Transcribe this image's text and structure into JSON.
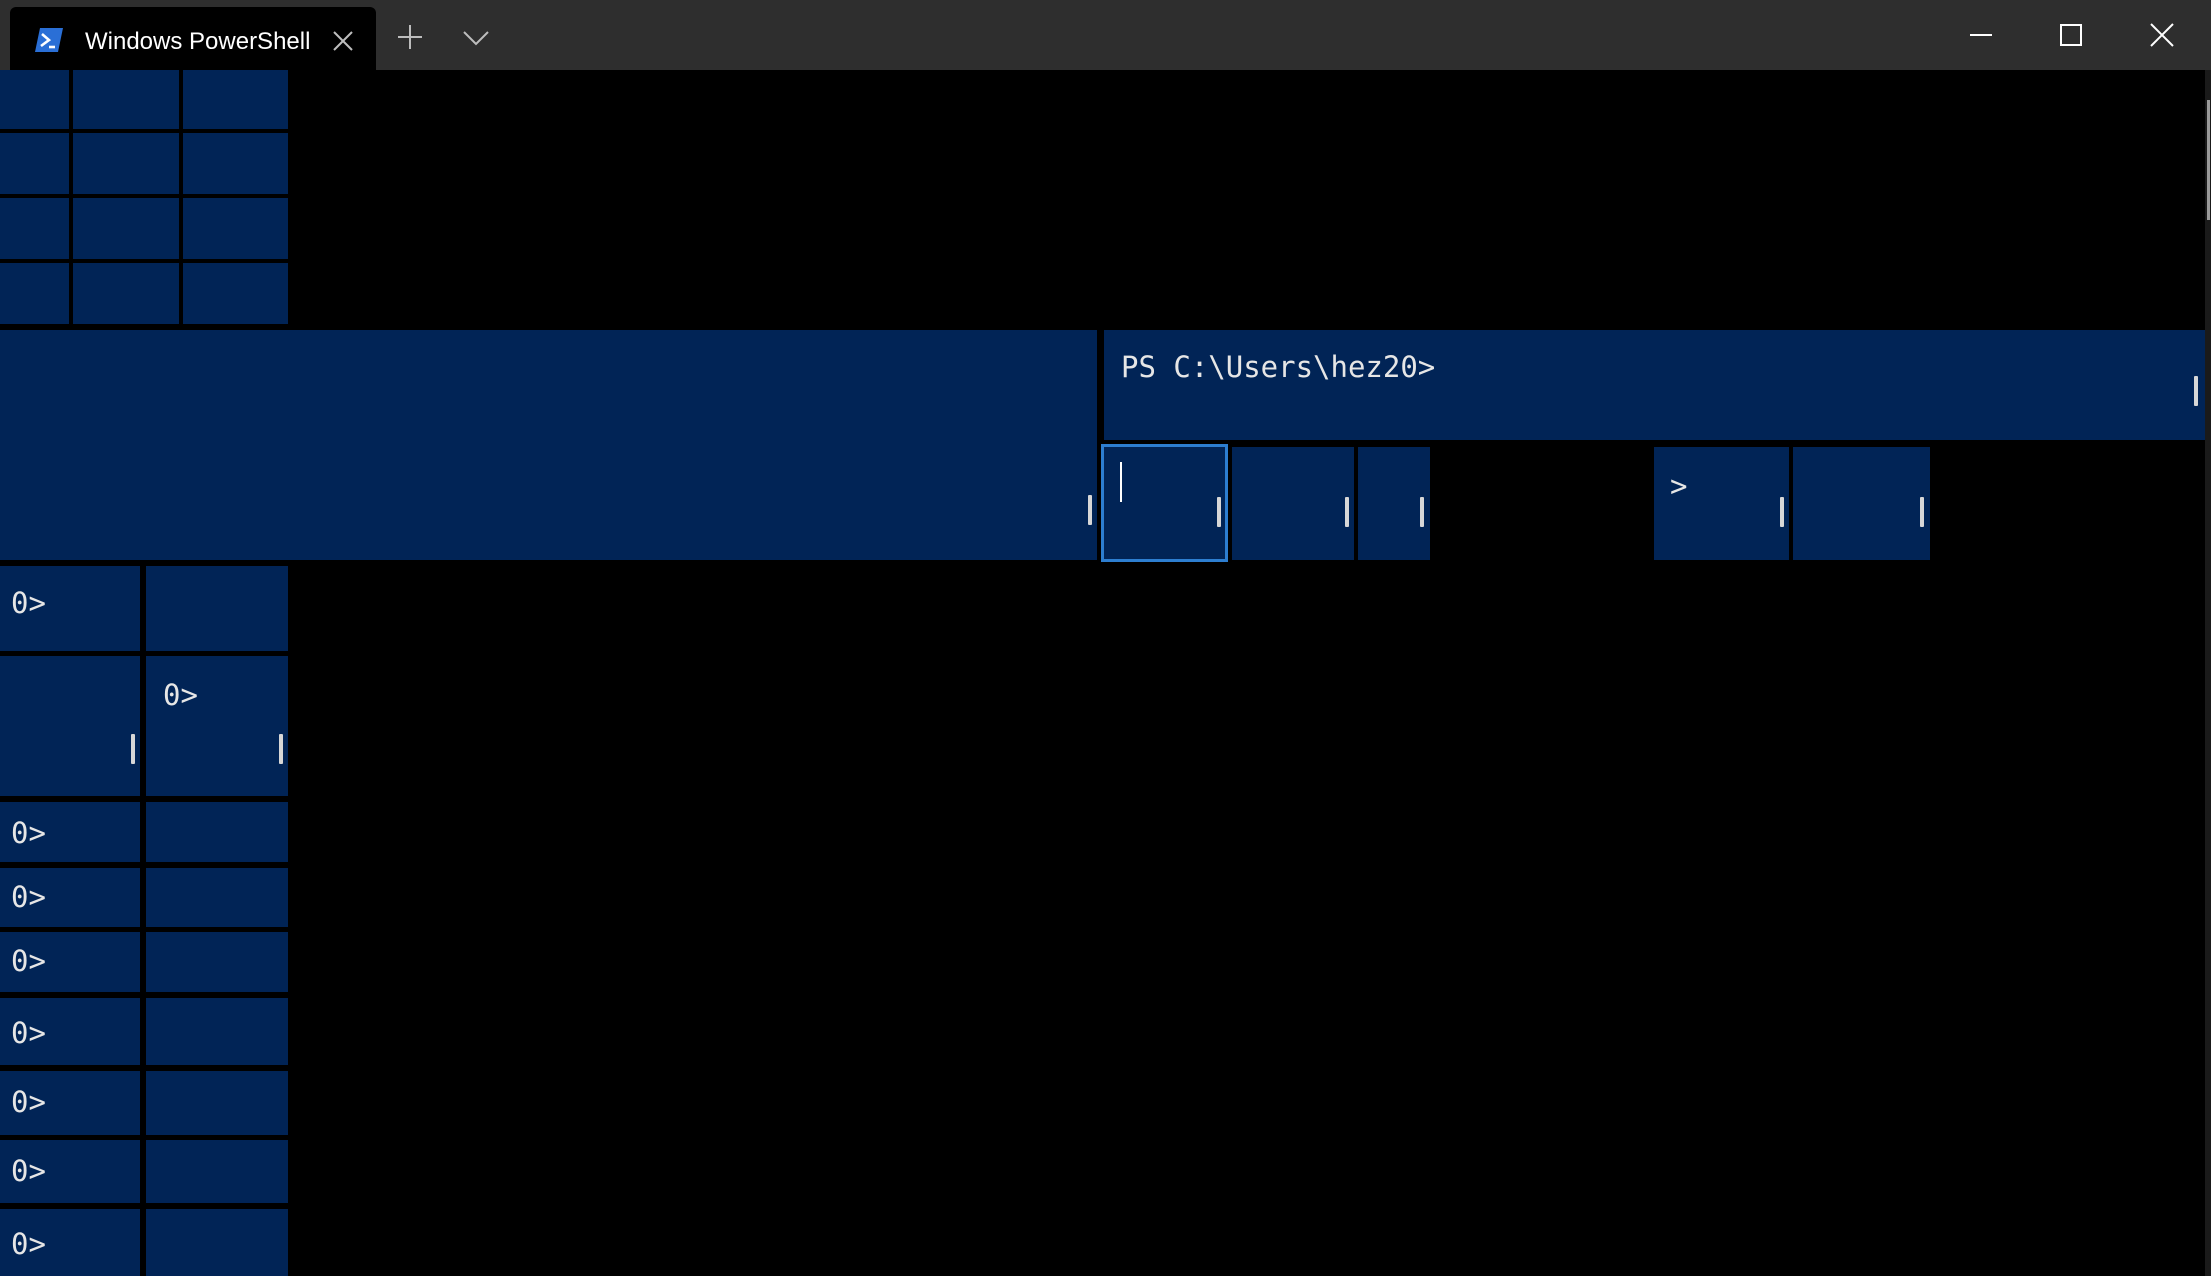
{
  "window": {
    "tab_title": "Windows PowerShell",
    "tab_icon": "powershell-icon",
    "controls": [
      "minimize-icon",
      "maximize-icon",
      "close-icon"
    ]
  },
  "colors": {
    "pane_background": "#012456",
    "focus_border": "#2d7ed0",
    "titlebar": "#2e2e2e",
    "terminal_background": "#000000"
  },
  "panes": {
    "prompt_full": "PS C:\\Users\\hez20>",
    "prompt_tail_a": "0>",
    "prompt_tail_b": "0>",
    "prompt_tail_c": "0>",
    "prompt_tail_d": "0>",
    "prompt_tail_e": "0>",
    "prompt_tail_f": "0>",
    "prompt_tail_g": "0>",
    "prompt_tail_h": "0>",
    "prompt_tail_i": "0>",
    "prompt_gt": ">"
  }
}
